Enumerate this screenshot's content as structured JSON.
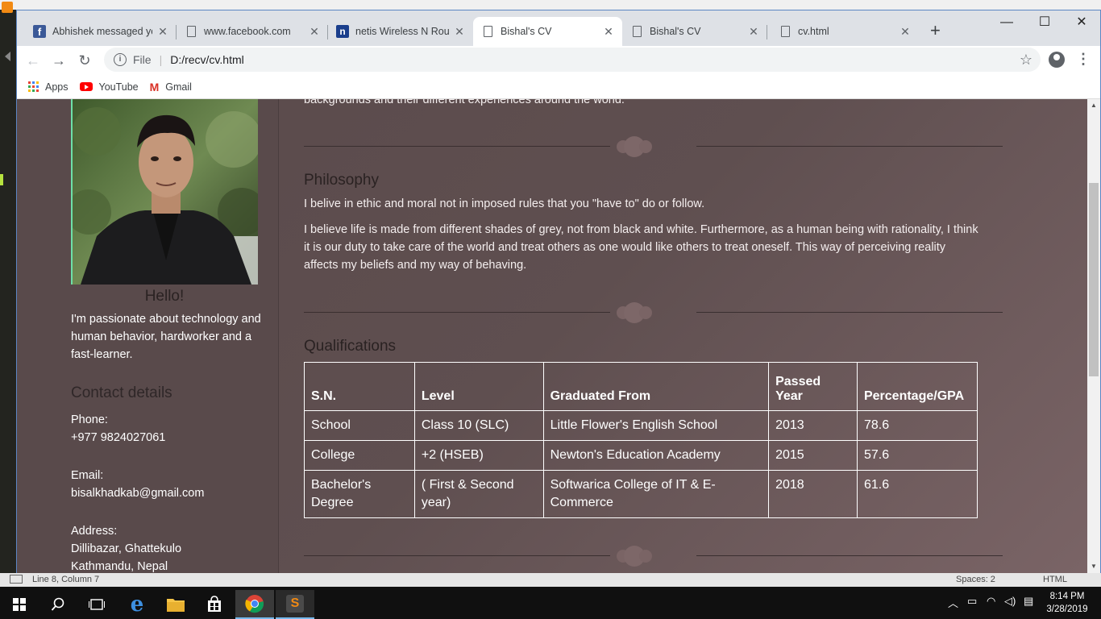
{
  "chrome": {
    "tabs": [
      {
        "title": "Abhishek messaged yo",
        "favicon": "facebook-icon"
      },
      {
        "title": "www.facebook.com",
        "favicon": "document-icon"
      },
      {
        "title": "netis Wireless N Router",
        "favicon": "netis-icon"
      },
      {
        "title": "Bishal's CV",
        "favicon": "document-icon",
        "active": true
      },
      {
        "title": "Bishal's CV",
        "favicon": "document-icon"
      },
      {
        "title": "cv.html",
        "favicon": "document-icon"
      }
    ],
    "address": {
      "scheme_label": "File",
      "url": "D:/recv/cv.html"
    },
    "bookmarks": [
      {
        "label": "Apps"
      },
      {
        "label": "YouTube"
      },
      {
        "label": "Gmail"
      }
    ]
  },
  "page": {
    "top_text": "backgrounds and their different experiences around the world.",
    "sidebar": {
      "hello": "Hello!",
      "about": "I'm passionate about technology and human behavior, hardworker and a fast-learner.",
      "contact_heading": "Contact details",
      "phone_label": "Phone:",
      "phone": "+977 9824027061",
      "email_label": "Email:",
      "email": "bisalkhadkab@gmail.com",
      "address_label": "Address:",
      "address_line1": "Dillibazar, Ghattekulo",
      "address_line2": "Kathmandu, Nepal"
    },
    "philosophy": {
      "heading": "Philosophy",
      "p1": "I belive in ethic and moral not in imposed rules that you \"have to\" do or follow.",
      "p2": "I believe life is made from different shades of grey, not from black and white. Furthermore, as a human being with rationality, I think it is our duty to take care of the world and treat others as one would like others to treat oneself. This way of perceiving reality affects my beliefs and my way of behaving."
    },
    "qualifications": {
      "heading": "Qualifications",
      "headers": [
        "S.N.",
        "Level",
        "Graduated From",
        "Passed Year",
        "Percentage/GPA"
      ],
      "rows": [
        [
          "School",
          "Class 10 (SLC)",
          "Little Flower's English School",
          "2013",
          "78.6"
        ],
        [
          "College",
          "+2 (HSEB)",
          "Newton's Education Academy",
          "2015",
          "57.6"
        ],
        [
          "Bachelor's Degree",
          "( First & Second year)",
          "Softwarica College of IT & E-Commerce",
          "2018",
          "61.6"
        ]
      ]
    }
  },
  "editor_status": {
    "position": "Line 8, Column 7",
    "spaces": "Spaces: 2",
    "syntax": "HTML"
  },
  "taskbar": {
    "time": "8:14 PM",
    "date": "3/28/2019"
  }
}
